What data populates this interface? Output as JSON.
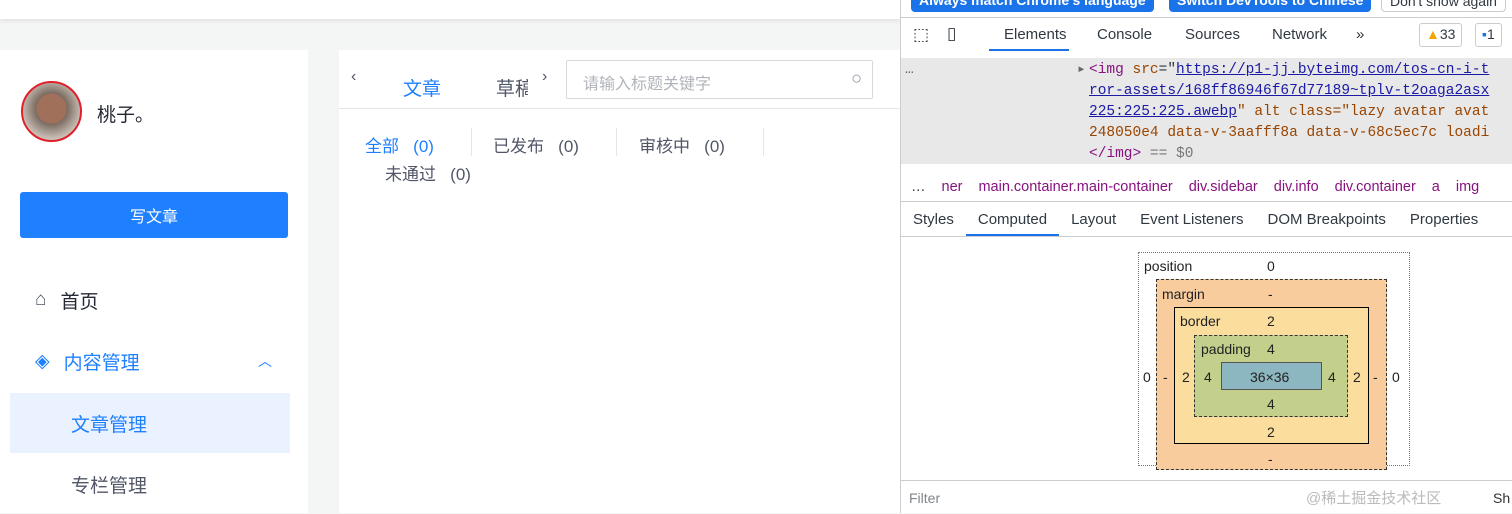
{
  "user": {
    "name": "桃子。"
  },
  "sidebar": {
    "write_button": "写文章",
    "items": [
      {
        "label": "首页",
        "icon": "home-icon"
      },
      {
        "label": "内容管理",
        "icon": "layers-icon"
      },
      {
        "label": "文章管理"
      },
      {
        "label": "专栏管理"
      }
    ]
  },
  "main": {
    "tabs": [
      "文章",
      "草稿"
    ],
    "search_placeholder": "请输入标题关键字",
    "filters": [
      {
        "label": "全部",
        "count": "(0)"
      },
      {
        "label": "已发布",
        "count": "(0)"
      },
      {
        "label": "审核中",
        "count": "(0)"
      },
      {
        "label": "未通过",
        "count": "(0)"
      }
    ]
  },
  "devtools": {
    "banner": [
      "Always match Chrome's language",
      "Switch DevTools to Chinese",
      "Don't show again"
    ],
    "tabs": [
      "Elements",
      "Console",
      "Sources",
      "Network",
      "»"
    ],
    "warnings": "33",
    "messages": "1",
    "code": {
      "l1_src": "https://p1-jj.byteimg.com/tos-cn-i-t",
      "l2": "ror-assets/168ff86946f67d77189~tplv-t2oaga2asx",
      "l3": "225:225:225.awebp",
      "l3b": "\" alt class=\"lazy avatar avat",
      "l4": "248050e4 data-v-3aafff8a data-v-68c5ec7c loadi",
      "l5_eq": " == $0"
    },
    "breadcrumb": [
      "ner",
      "main.container.main-container",
      "div.sidebar",
      "div.info",
      "div.container",
      "a",
      "img"
    ],
    "subtabs": [
      "Styles",
      "Computed",
      "Layout",
      "Event Listeners",
      "DOM Breakpoints",
      "Properties"
    ],
    "box": {
      "position_label": "position",
      "position": "0",
      "margin_label": "margin",
      "margin": "-",
      "border_label": "border",
      "border": "2",
      "padding_label": "padding",
      "padding": "4",
      "content": "36×36",
      "outer_side": "0"
    },
    "filter_placeholder": "Filter",
    "watermark": "@稀土掘金技术社区",
    "sh": "Sh"
  }
}
